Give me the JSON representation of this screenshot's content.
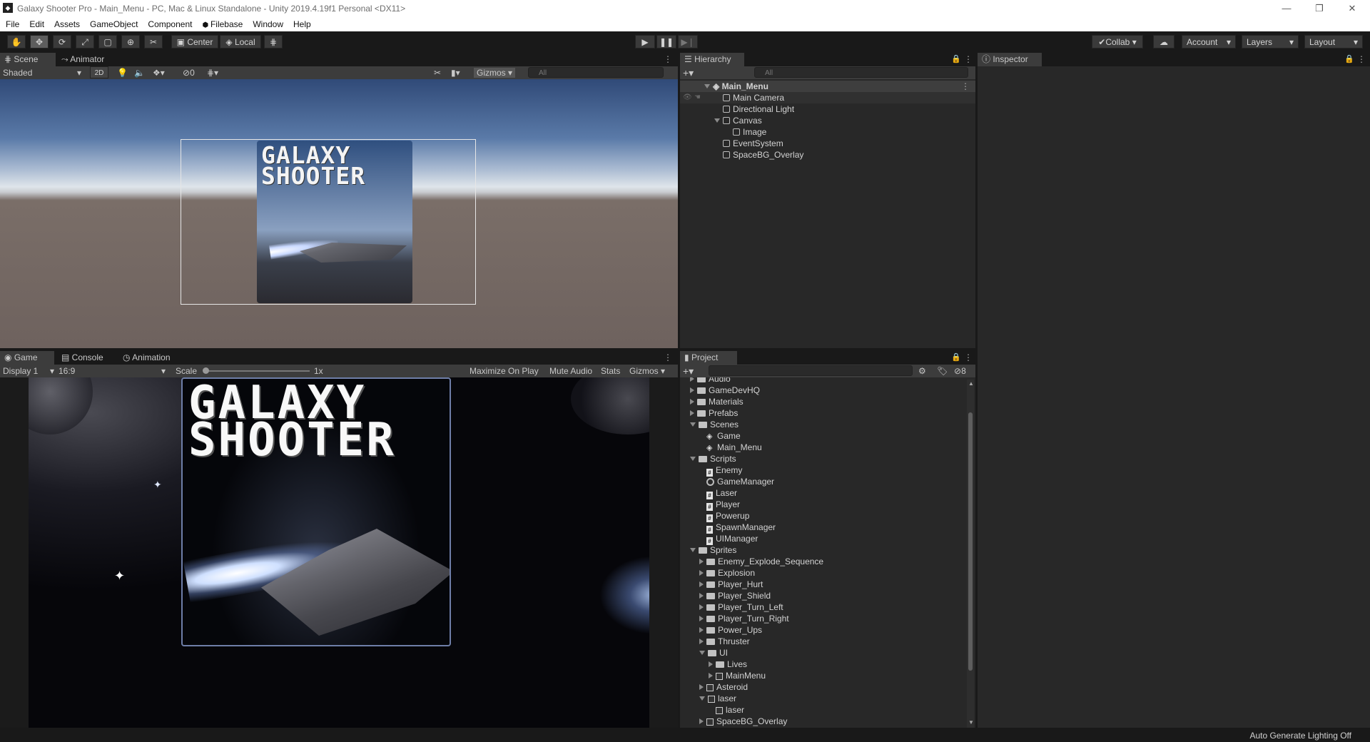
{
  "window": {
    "title": "Galaxy Shooter Pro - Main_Menu - PC, Mac & Linux Standalone - Unity 2019.4.19f1 Personal <DX11>",
    "controls": {
      "minimize": "—",
      "restore": "❐",
      "close": "✕"
    }
  },
  "menu": [
    "File",
    "Edit",
    "Assets",
    "GameObject",
    "Component",
    "Filebase",
    "Window",
    "Help"
  ],
  "toolbar": {
    "pivot": "Center",
    "space": "Local",
    "collab": "Collab",
    "account": "Account",
    "layers": "Layers",
    "layout": "Layout"
  },
  "scene_panel": {
    "tabs": [
      "Scene",
      "Animator"
    ],
    "shading": "Shaded",
    "mode_2d": "2D",
    "hidden_count": "0",
    "gizmos": "Gizmos",
    "search_placeholder": "All",
    "logo_line1": "GALAXY",
    "logo_line2": "SHOOTER"
  },
  "game_panel": {
    "tabs": [
      "Game",
      "Console",
      "Animation"
    ],
    "display": "Display 1",
    "aspect": "16:9",
    "scale_label": "Scale",
    "scale_value": "1x",
    "maximize": "Maximize On Play",
    "mute": "Mute Audio",
    "stats": "Stats",
    "gizmos": "Gizmos",
    "logo_line1": "GALAXY",
    "logo_line2": "SHOOTER"
  },
  "hierarchy": {
    "tab": "Hierarchy",
    "search_placeholder": "All",
    "scene": "Main_Menu",
    "items": [
      {
        "label": "Main Camera",
        "indent": 1
      },
      {
        "label": "Directional Light",
        "indent": 1
      },
      {
        "label": "Canvas",
        "indent": 1
      },
      {
        "label": "Image",
        "indent": 2
      },
      {
        "label": "EventSystem",
        "indent": 1
      },
      {
        "label": "SpaceBG_Overlay",
        "indent": 1
      }
    ]
  },
  "inspector": {
    "tab": "Inspector"
  },
  "project": {
    "tab": "Project",
    "hidden_count": "8",
    "items": [
      {
        "label": "Audio",
        "type": "folder",
        "indent": 0
      },
      {
        "label": "GameDevHQ",
        "type": "folder",
        "indent": 0
      },
      {
        "label": "Materials",
        "type": "folder",
        "indent": 0
      },
      {
        "label": "Prefabs",
        "type": "folder",
        "indent": 0
      },
      {
        "label": "Scenes",
        "type": "folder-open",
        "indent": 0
      },
      {
        "label": "Game",
        "type": "scene",
        "indent": 1
      },
      {
        "label": "Main_Menu",
        "type": "scene",
        "indent": 1
      },
      {
        "label": "Scripts",
        "type": "folder-open",
        "indent": 0
      },
      {
        "label": "Enemy",
        "type": "script",
        "indent": 1
      },
      {
        "label": "GameManager",
        "type": "gear",
        "indent": 1
      },
      {
        "label": "Laser",
        "type": "script",
        "indent": 1
      },
      {
        "label": "Player",
        "type": "script",
        "indent": 1
      },
      {
        "label": "Powerup",
        "type": "script",
        "indent": 1
      },
      {
        "label": "SpawnManager",
        "type": "script",
        "indent": 1
      },
      {
        "label": "UIManager",
        "type": "script",
        "indent": 1
      },
      {
        "label": "Sprites",
        "type": "folder-open",
        "indent": 0
      },
      {
        "label": "Enemy_Explode_Sequence",
        "type": "folder",
        "indent": 1
      },
      {
        "label": "Explosion",
        "type": "folder",
        "indent": 1
      },
      {
        "label": "Player_Hurt",
        "type": "folder",
        "indent": 1
      },
      {
        "label": "Player_Shield",
        "type": "folder",
        "indent": 1
      },
      {
        "label": "Player_Turn_Left",
        "type": "folder",
        "indent": 1
      },
      {
        "label": "Player_Turn_Right",
        "type": "folder",
        "indent": 1
      },
      {
        "label": "Power_Ups",
        "type": "folder",
        "indent": 1
      },
      {
        "label": "Thruster",
        "type": "folder",
        "indent": 1
      },
      {
        "label": "UI",
        "type": "folder-open",
        "indent": 1
      },
      {
        "label": "Lives",
        "type": "folder",
        "indent": 2
      },
      {
        "label": "MainMenu",
        "type": "sprite-collapsed",
        "indent": 2
      },
      {
        "label": "Asteroid",
        "type": "sprite-collapsed",
        "indent": 1
      },
      {
        "label": "laser",
        "type": "sprite-open",
        "indent": 1
      },
      {
        "label": "laser",
        "type": "sprite",
        "indent": 2
      },
      {
        "label": "SpaceBG_Overlay",
        "type": "sprite-collapsed",
        "indent": 1
      }
    ]
  },
  "status": {
    "text": "Auto Generate Lighting Off"
  }
}
